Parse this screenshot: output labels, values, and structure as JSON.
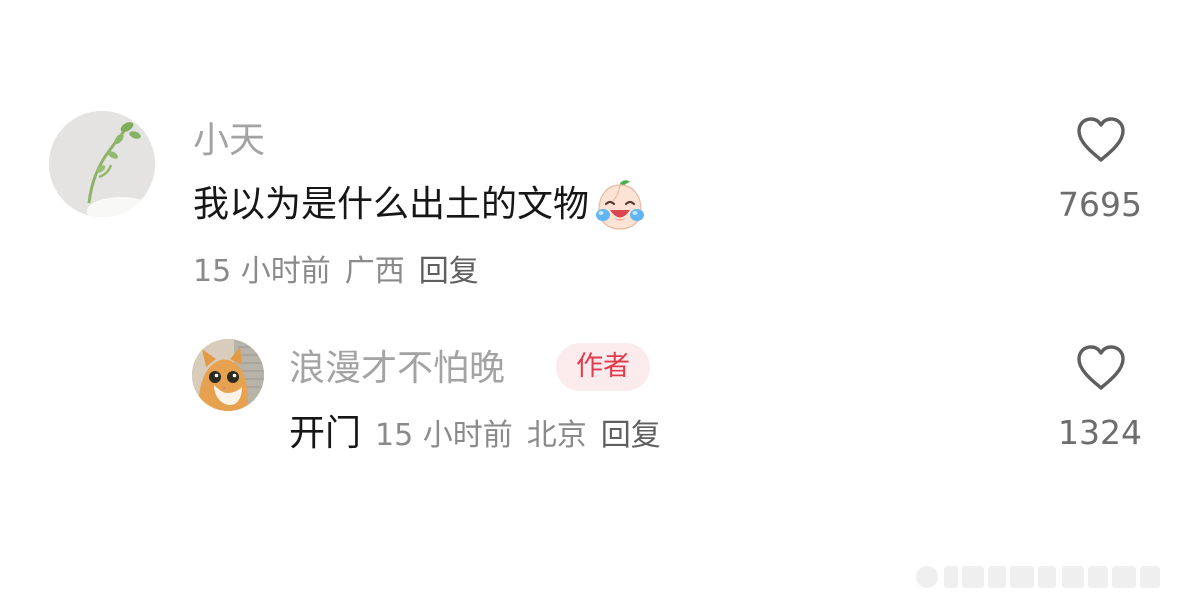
{
  "comment": {
    "username": "小天",
    "text": "我以为是什么出土的文物",
    "emoji": "laughing-crying-peach-emoji",
    "time": "15 小时前",
    "location": "广西",
    "reply_label": "回复",
    "like_count": "7695",
    "like_icon": "heart-outline-icon"
  },
  "reply": {
    "username": "浪漫才不怕晚",
    "badge": "作者",
    "text": "开门",
    "time": "15 小时前",
    "location": "北京",
    "reply_label": "回复",
    "like_count": "1324",
    "like_icon": "heart-outline-icon"
  },
  "colors": {
    "username": "#a3a3a3",
    "meta": "#8a8a8a",
    "content": "#161616",
    "badge_bg": "#fcebed",
    "badge_text": "#e03c4f",
    "like_icon": "#5f5f5f"
  }
}
